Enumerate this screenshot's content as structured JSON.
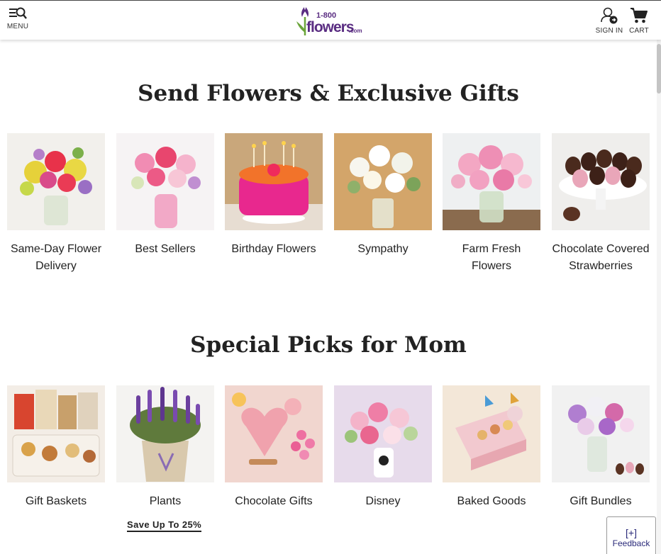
{
  "header": {
    "menu_label": "MENU",
    "logo": {
      "top": "1-800",
      "main": "flowers",
      "suffix": ".com"
    },
    "signin_label": "SIGN IN",
    "cart_label": "CART"
  },
  "sections": [
    {
      "title": "Send Flowers & Exclusive Gifts",
      "tiles": [
        {
          "label": "Same-Day Flower Delivery"
        },
        {
          "label": "Best Sellers"
        },
        {
          "label": "Birthday Flowers"
        },
        {
          "label": "Sympathy"
        },
        {
          "label": "Farm Fresh Flowers"
        },
        {
          "label": "Chocolate Covered Strawberries"
        }
      ]
    },
    {
      "title": "Special Picks for Mom",
      "tiles": [
        {
          "label": "Gift Baskets"
        },
        {
          "label": "Plants"
        },
        {
          "label": "Chocolate Gifts"
        },
        {
          "label": "Disney"
        },
        {
          "label": "Baked Goods"
        },
        {
          "label": "Gift Bundles"
        }
      ]
    }
  ],
  "promo": {
    "label": "Save Up To 25%"
  },
  "feedback": {
    "icon": "[+]",
    "label": "Feedback"
  },
  "colors": {
    "brand_purple": "#5a2d82",
    "brand_green": "#6aa53a"
  }
}
